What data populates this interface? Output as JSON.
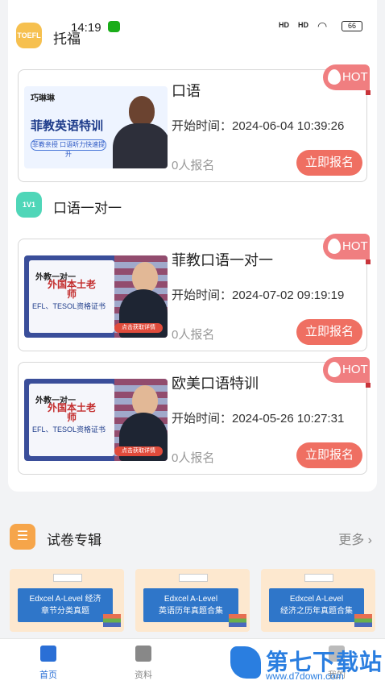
{
  "status_bar": {
    "time": "14:19",
    "signal1": "HD",
    "signal2": "HD",
    "battery": "66"
  },
  "sections": {
    "toefl": {
      "badge": "TOEFL",
      "title": "托福"
    },
    "oneonone": {
      "badge": "1V1",
      "title": "口语一对一"
    }
  },
  "courses": [
    {
      "hot_label": "HOT",
      "name": "口语",
      "start": "开始时间：2024-06-04 10:39:26",
      "count": "0人报名",
      "enroll_label": "立即报名",
      "thumb": {
        "brand": "巧琳琳",
        "headline": "菲教英语特训",
        "tagline": "菲教亲授 口语听力快速提升"
      }
    },
    {
      "hot_label": "HOT",
      "name": "菲教口语一对一",
      "start": "开始时间：2024-07-02 09:19:19",
      "count": "0人报名",
      "enroll_label": "立即报名",
      "thumb": {
        "line1": "外教一对一",
        "line2": "外国本土老师",
        "line3": "EFL、TESOL资格证书",
        "cta": "点击获取详情"
      }
    },
    {
      "hot_label": "HOT",
      "name": "欧美口语特训",
      "start": "开始时间：2024-05-26 10:27:31",
      "count": "0人报名",
      "enroll_label": "立即报名",
      "thumb": {
        "line1": "外教一对一",
        "line2": "外国本土老师",
        "line3": "EFL、TESOL资格证书",
        "cta": "点击获取详情"
      }
    }
  ],
  "exam_section": {
    "title": "试卷专辑",
    "more_label": "更多 ›",
    "items": [
      {
        "line1": "Edxcel A-Level 经济",
        "line2": "章节分类真题"
      },
      {
        "line1": "Edxcel A-Level",
        "line2": "英语历年真题合集"
      },
      {
        "line1": "Edxcel A-Level",
        "line2": "经济之历年真题合集"
      }
    ]
  },
  "tabbar": {
    "tabs": [
      {
        "label": "首页",
        "active": true
      },
      {
        "label": "资料",
        "active": false
      },
      {
        "label": "我的",
        "active": false
      }
    ]
  },
  "watermark": {
    "title": "第七下载站",
    "url": "www.d7down.com"
  },
  "colors": {
    "accent": "#ef6f62",
    "hot": "#f07e80",
    "tab_active": "#2a6fd6",
    "exam_icon": "#f6a54a"
  }
}
